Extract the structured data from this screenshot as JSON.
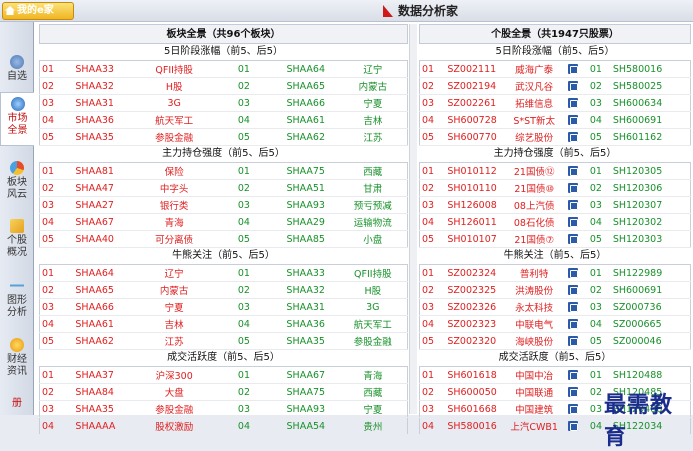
{
  "app": {
    "logo_text": "我的e家",
    "title": "数据分析家"
  },
  "sidebar": {
    "items": [
      {
        "label": "自选",
        "active": false
      },
      {
        "label": "市场全景",
        "active": true
      },
      {
        "label": "板块风云",
        "active": false
      },
      {
        "label": "个股概况",
        "active": false
      },
      {
        "label": "图形分析",
        "active": false
      },
      {
        "label": "财经资讯",
        "active": false
      },
      {
        "label": "册",
        "active": false
      }
    ]
  },
  "left": {
    "title": "板块全景（共96个板块）",
    "sections": [
      {
        "title": "5日阶段涨幅（前5、后5）",
        "rows": [
          [
            "01",
            "SHAA33",
            "QFII持股",
            "01",
            "SHAA64",
            "辽宁"
          ],
          [
            "02",
            "SHAA32",
            "H股",
            "02",
            "SHAA65",
            "内蒙古"
          ],
          [
            "03",
            "SHAA31",
            "3G",
            "03",
            "SHAA66",
            "宁夏"
          ],
          [
            "04",
            "SHAA36",
            "航天军工",
            "04",
            "SHAA61",
            "吉林"
          ],
          [
            "05",
            "SHAA35",
            "参股金融",
            "05",
            "SHAA62",
            "江苏"
          ]
        ]
      },
      {
        "title": "主力持仓强度（前5、后5）",
        "rows": [
          [
            "01",
            "SHAA81",
            "保险",
            "01",
            "SHAA75",
            "西藏"
          ],
          [
            "02",
            "SHAA47",
            "中字头",
            "02",
            "SHAA51",
            "甘肃"
          ],
          [
            "03",
            "SHAA27",
            "银行类",
            "03",
            "SHAA93",
            "预亏预减"
          ],
          [
            "04",
            "SHAA67",
            "青海",
            "04",
            "SHAA29",
            "运输物流"
          ],
          [
            "05",
            "SHAA40",
            "可分离债",
            "05",
            "SHAA85",
            "小盘"
          ]
        ]
      },
      {
        "title": "牛熊关注（前5、后5）",
        "rows": [
          [
            "01",
            "SHAA64",
            "辽宁",
            "01",
            "SHAA33",
            "QFII持股"
          ],
          [
            "02",
            "SHAA65",
            "内蒙古",
            "02",
            "SHAA32",
            "H股"
          ],
          [
            "03",
            "SHAA66",
            "宁夏",
            "03",
            "SHAA31",
            "3G"
          ],
          [
            "04",
            "SHAA61",
            "吉林",
            "04",
            "SHAA36",
            "航天军工"
          ],
          [
            "05",
            "SHAA62",
            "江苏",
            "05",
            "SHAA35",
            "参股金融"
          ]
        ]
      },
      {
        "title": "成交活跃度（前5、后5）",
        "rows": [
          [
            "01",
            "SHAA37",
            "沪深300",
            "01",
            "SHAA67",
            "青海"
          ],
          [
            "02",
            "SHAA84",
            "大盘",
            "02",
            "SHAA75",
            "西藏"
          ],
          [
            "03",
            "SHAA35",
            "参股金融",
            "03",
            "SHAA93",
            "宁夏"
          ],
          [
            "04",
            "SHAAAA",
            "股权激励",
            "04",
            "SHAA54",
            "贵州"
          ]
        ]
      }
    ]
  },
  "right": {
    "title": "个股全景（共1947只股票）",
    "sections": [
      {
        "title": "5日阶段涨幅（前5、后5）",
        "rows": [
          [
            "01",
            "SZ002111",
            "威海广泰",
            "01",
            "SH580016"
          ],
          [
            "02",
            "SZ002194",
            "武汉凡谷",
            "02",
            "SH580025"
          ],
          [
            "03",
            "SZ002261",
            "拓维信息",
            "03",
            "SH600634"
          ],
          [
            "04",
            "SH600728",
            "S*ST新太",
            "04",
            "SH600691"
          ],
          [
            "05",
            "SH600770",
            "综艺股份",
            "05",
            "SH601162"
          ]
        ]
      },
      {
        "title": "主力持仓强度（前5、后5）",
        "rows": [
          [
            "01",
            "SH010112",
            "21国债⑫",
            "01",
            "SH120305"
          ],
          [
            "02",
            "SH010110",
            "21国债⑩",
            "02",
            "SH120306"
          ],
          [
            "03",
            "SH126008",
            "08上汽债",
            "03",
            "SH120307"
          ],
          [
            "04",
            "SH126011",
            "08石化债",
            "04",
            "SH120302"
          ],
          [
            "05",
            "SH010107",
            "21国债⑦",
            "05",
            "SH120303"
          ]
        ]
      },
      {
        "title": "牛熊关注（前5、后5）",
        "rows": [
          [
            "01",
            "SZ002324",
            "普利特",
            "01",
            "SH122989"
          ],
          [
            "02",
            "SZ002325",
            "洪涛股份",
            "02",
            "SH600691"
          ],
          [
            "03",
            "SZ002326",
            "永太科技",
            "03",
            "SZ000736"
          ],
          [
            "04",
            "SZ002323",
            "中联电气",
            "04",
            "SZ000665"
          ],
          [
            "05",
            "SZ002320",
            "海峡股份",
            "05",
            "SZ000046"
          ]
        ]
      },
      {
        "title": "成交活跃度（前5、后5）",
        "rows": [
          [
            "01",
            "SH601618",
            "中国中冶",
            "01",
            "SH120488"
          ],
          [
            "02",
            "SH600050",
            "中国联通",
            "02",
            "SH120485"
          ],
          [
            "03",
            "SH601668",
            "中国建筑",
            "03",
            "SH120486"
          ],
          [
            "04",
            "SH580016",
            "上汽CWB1",
            "04",
            "SH122034"
          ]
        ]
      }
    ]
  },
  "watermark": "最需教育",
  "colors": {
    "up": "#e02020",
    "down": "#18912a",
    "badge": "#2a5aa8"
  }
}
